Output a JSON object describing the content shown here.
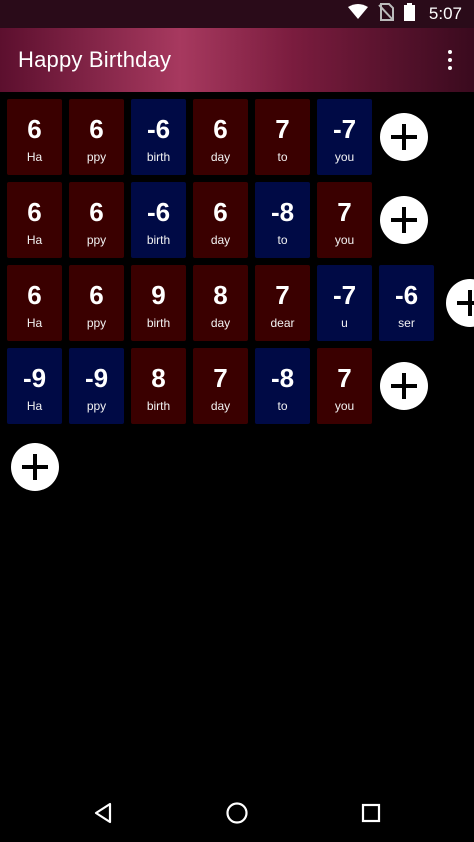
{
  "status_bar": {
    "time": "5:07",
    "icons": [
      "wifi-icon",
      "no-sim-icon",
      "battery-icon"
    ]
  },
  "app_bar": {
    "title": "Happy Birthday",
    "menu_icon": "more-vert-icon"
  },
  "rows": [
    {
      "tiles": [
        {
          "number": "6",
          "word": "Ha",
          "sign": "pos"
        },
        {
          "number": "6",
          "word": "ppy",
          "sign": "pos"
        },
        {
          "number": "-6",
          "word": "birth",
          "sign": "neg"
        },
        {
          "number": "6",
          "word": "day",
          "sign": "pos"
        },
        {
          "number": "7",
          "word": "to",
          "sign": "pos"
        },
        {
          "number": "-7",
          "word": "you",
          "sign": "neg"
        }
      ]
    },
    {
      "tiles": [
        {
          "number": "6",
          "word": "Ha",
          "sign": "pos"
        },
        {
          "number": "6",
          "word": "ppy",
          "sign": "pos"
        },
        {
          "number": "-6",
          "word": "birth",
          "sign": "neg"
        },
        {
          "number": "6",
          "word": "day",
          "sign": "pos"
        },
        {
          "number": "-8",
          "word": "to",
          "sign": "neg"
        },
        {
          "number": "7",
          "word": "you",
          "sign": "pos"
        }
      ]
    },
    {
      "tiles": [
        {
          "number": "6",
          "word": "Ha",
          "sign": "pos"
        },
        {
          "number": "6",
          "word": "ppy",
          "sign": "pos"
        },
        {
          "number": "9",
          "word": "birth",
          "sign": "pos"
        },
        {
          "number": "8",
          "word": "day",
          "sign": "pos"
        },
        {
          "number": "7",
          "word": "dear",
          "sign": "pos"
        },
        {
          "number": "-7",
          "word": "u",
          "sign": "neg"
        },
        {
          "number": "-6",
          "word": "ser",
          "sign": "neg"
        }
      ]
    },
    {
      "tiles": [
        {
          "number": "-9",
          "word": "Ha",
          "sign": "neg"
        },
        {
          "number": "-9",
          "word": "ppy",
          "sign": "neg"
        },
        {
          "number": "8",
          "word": "birth",
          "sign": "pos"
        },
        {
          "number": "7",
          "word": "day",
          "sign": "pos"
        },
        {
          "number": "-8",
          "word": "to",
          "sign": "neg"
        },
        {
          "number": "7",
          "word": "you",
          "sign": "pos"
        }
      ]
    }
  ],
  "colors": {
    "positive_tile": "#3a0000",
    "negative_tile": "#000a45",
    "add_button": "#ffffff"
  },
  "nav_bar": {
    "buttons": [
      "back-icon",
      "home-icon",
      "recents-icon"
    ]
  }
}
